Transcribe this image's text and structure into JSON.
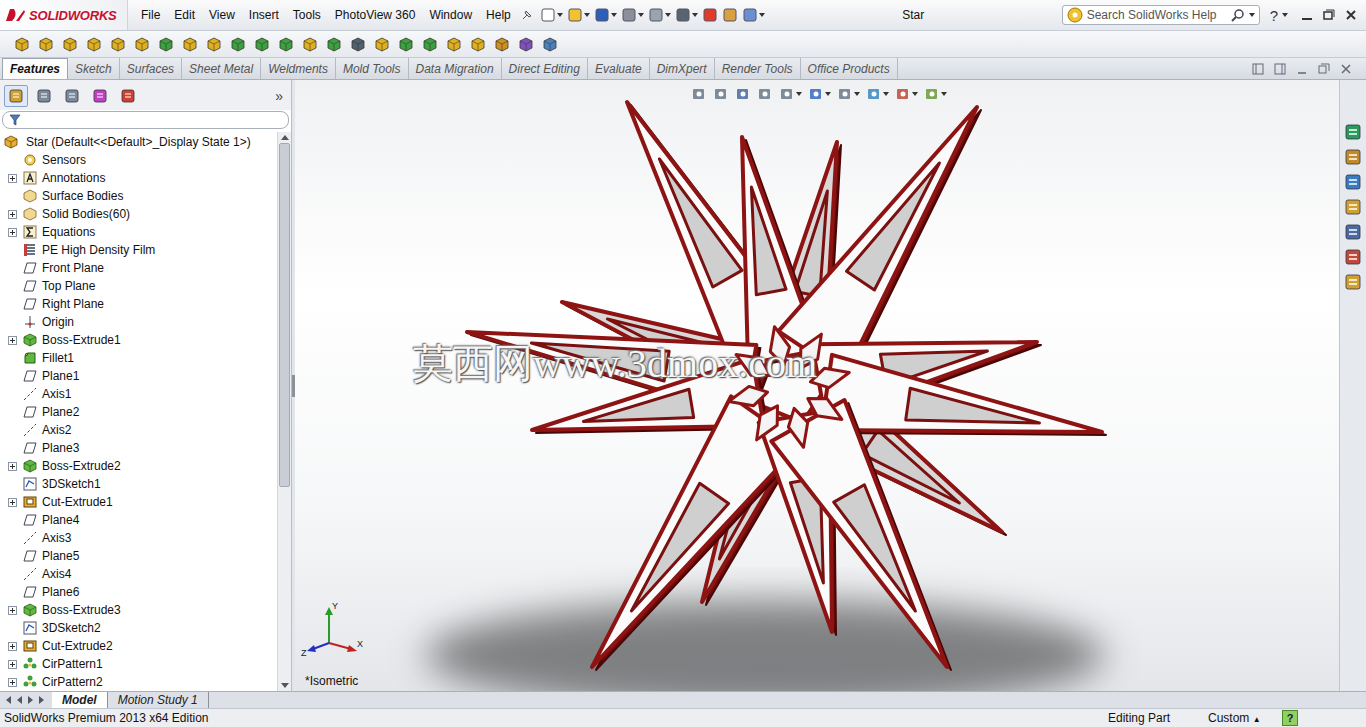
{
  "app": {
    "logo": "SOLIDWORKS"
  },
  "menu": [
    "File",
    "Edit",
    "View",
    "Insert",
    "Tools",
    "PhotoView 360",
    "Window",
    "Help"
  ],
  "window": {
    "title": "Star"
  },
  "search": {
    "placeholder": "Search SolidWorks Help"
  },
  "help_button": "?",
  "tabs": [
    {
      "label": "Features",
      "selected": true
    },
    {
      "label": "Sketch",
      "selected": false
    },
    {
      "label": "Surfaces",
      "selected": false
    },
    {
      "label": "Sheet Metal",
      "selected": false
    },
    {
      "label": "Weldments",
      "selected": false
    },
    {
      "label": "Mold Tools",
      "selected": false
    },
    {
      "label": "Data Migration",
      "selected": false
    },
    {
      "label": "Direct Editing",
      "selected": false
    },
    {
      "label": "Evaluate",
      "selected": false
    },
    {
      "label": "DimXpert",
      "selected": false
    },
    {
      "label": "Render Tools",
      "selected": false
    },
    {
      "label": "Office Products",
      "selected": false
    }
  ],
  "panel": {
    "collapse": "»",
    "tree_scrollbar": {
      "level": 0.64
    }
  },
  "feature_tree": {
    "root": "Star  (Default<<Default>_Display State 1>)",
    "items": [
      {
        "label": "Sensors",
        "kind": "sensor",
        "expandable": false
      },
      {
        "label": "Annotations",
        "kind": "annotation",
        "expandable": true
      },
      {
        "label": "Surface Bodies",
        "kind": "folder",
        "expandable": false
      },
      {
        "label": "Solid Bodies(60)",
        "kind": "folder",
        "expandable": true
      },
      {
        "label": "Equations",
        "kind": "equation",
        "expandable": true
      },
      {
        "label": "PE High Density Film",
        "kind": "material",
        "expandable": false
      },
      {
        "label": "Front Plane",
        "kind": "plane",
        "expandable": false
      },
      {
        "label": "Top Plane",
        "kind": "plane",
        "expandable": false
      },
      {
        "label": "Right Plane",
        "kind": "plane",
        "expandable": false
      },
      {
        "label": "Origin",
        "kind": "origin",
        "expandable": false
      },
      {
        "label": "Boss-Extrude1",
        "kind": "extrude",
        "expandable": true
      },
      {
        "label": "Fillet1",
        "kind": "fillet",
        "expandable": false
      },
      {
        "label": "Plane1",
        "kind": "plane",
        "expandable": false
      },
      {
        "label": "Axis1",
        "kind": "axis",
        "expandable": false
      },
      {
        "label": "Plane2",
        "kind": "plane",
        "expandable": false
      },
      {
        "label": "Axis2",
        "kind": "axis",
        "expandable": false
      },
      {
        "label": "Plane3",
        "kind": "plane",
        "expandable": false
      },
      {
        "label": "Boss-Extrude2",
        "kind": "extrude",
        "expandable": true
      },
      {
        "label": "3DSketch1",
        "kind": "sketch",
        "expandable": false
      },
      {
        "label": "Cut-Extrude1",
        "kind": "cut",
        "expandable": true
      },
      {
        "label": "Plane4",
        "kind": "plane",
        "expandable": false
      },
      {
        "label": "Axis3",
        "kind": "axis",
        "expandable": false
      },
      {
        "label": "Plane5",
        "kind": "plane",
        "expandable": false
      },
      {
        "label": "Axis4",
        "kind": "axis",
        "expandable": false
      },
      {
        "label": "Plane6",
        "kind": "plane",
        "expandable": false
      },
      {
        "label": "Boss-Extrude3",
        "kind": "extrude",
        "expandable": true
      },
      {
        "label": "3DSketch2",
        "kind": "sketch",
        "expandable": false
      },
      {
        "label": "Cut-Extrude2",
        "kind": "cut",
        "expandable": true
      },
      {
        "label": "CirPattern1",
        "kind": "pattern",
        "expandable": true
      },
      {
        "label": "CirPattern2",
        "kind": "pattern",
        "expandable": true
      }
    ]
  },
  "viewport": {
    "view_label": "*Isometric",
    "watermark": "莫西网www.3dmox.com",
    "triad": {
      "x": "X",
      "y": "Y",
      "z": "Z"
    }
  },
  "bottom_tabs": [
    {
      "label": "Model",
      "selected": true
    },
    {
      "label": "Motion Study 1",
      "selected": false
    }
  ],
  "status_bar": {
    "edition": "SolidWorks Premium 2013 x64 Edition",
    "mode": "Editing Part",
    "units": "Custom",
    "units_arrow": "▲",
    "help": "?"
  }
}
